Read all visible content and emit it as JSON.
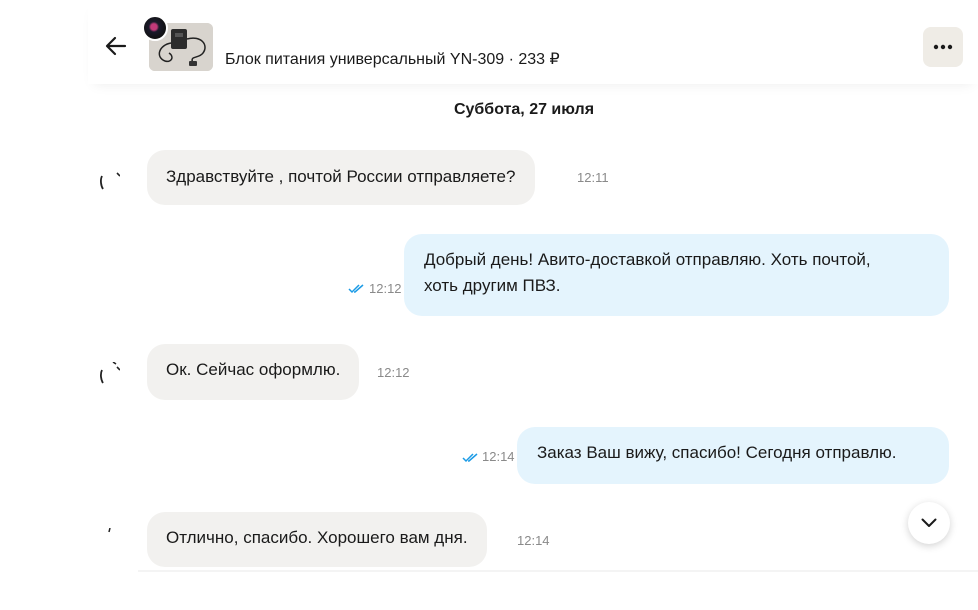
{
  "header": {
    "item_title": "Блок питания универсальный YN-309 · 233 ₽"
  },
  "date_separator": "Суббота, 27 июля",
  "messages": [
    {
      "direction": "in",
      "text": "Здравствуйте , почтой России отправляете?",
      "time": "12:11"
    },
    {
      "direction": "out",
      "lines": [
        "Добрый день! Авито-доставкой отправляю. Хоть почтой,",
        "хоть другим ПВЗ."
      ],
      "time": "12:12",
      "read": true
    },
    {
      "direction": "in",
      "text": "Ок. Сейчас оформлю.",
      "time": "12:12"
    },
    {
      "direction": "out",
      "text": "Заказ Ваш вижу, спасибо! Сегодня отправлю.",
      "time": "12:14",
      "read": true
    },
    {
      "direction": "in",
      "text": "Отлично, спасибо. Хорошего вам дня.",
      "time": "12:14"
    }
  ],
  "colors": {
    "incoming_bubble": "#f2f1ef",
    "outgoing_bubble": "#e4f4fd",
    "read_ticks": "#1b9be6",
    "more_button_bg": "#efece6"
  },
  "icons": {
    "back": "arrow-left-icon",
    "more": "more-horizontal-icon",
    "scroll_down": "chevron-down-icon",
    "read": "double-check-icon"
  }
}
